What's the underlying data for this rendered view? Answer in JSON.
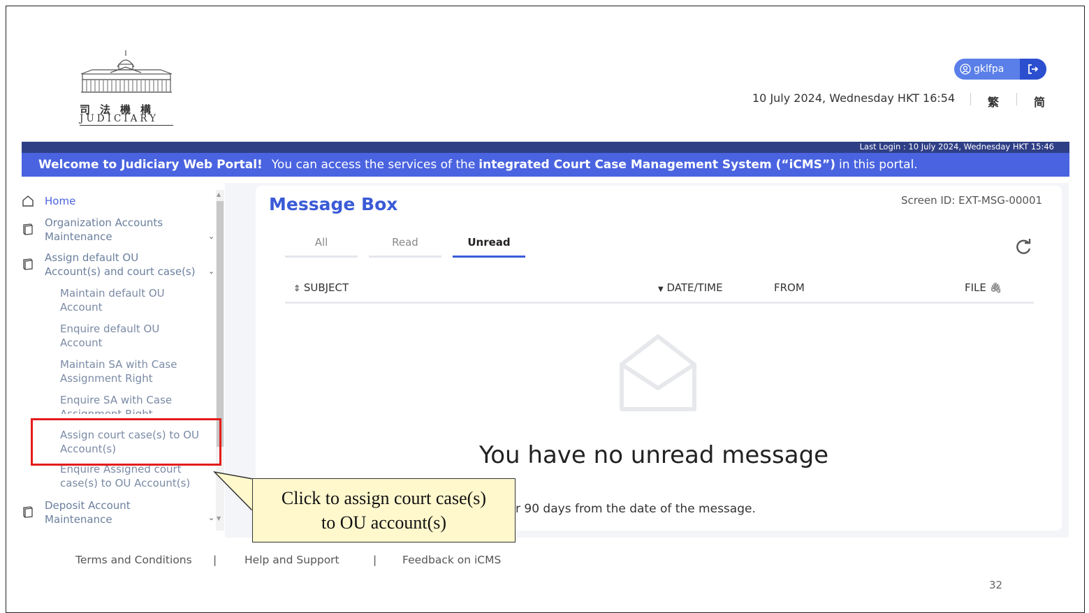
{
  "header": {
    "logo_cn": "司法機構",
    "logo_en": "JUDICIARY",
    "username": "gklfpa",
    "datetime": "10 July 2024, Wednesday HKT 16:54",
    "lang_trad": "繁",
    "lang_simp": "简"
  },
  "banner": {
    "last_login": "Last Login : 10 July 2024, Wednesday HKT 15:46",
    "welcome": "Welcome to Judiciary Web Portal!",
    "text_1": "You can access the services of the",
    "text_bold": "integrated Court Case Management System (“iCMS”)",
    "text_2": "in this portal."
  },
  "sidebar": {
    "home": "Home",
    "org_1": "Organization Accounts",
    "org_2": "Maintenance",
    "assign_1": "Assign default OU",
    "assign_2": "Account(s) and court case(s)",
    "sub1_1": "Maintain default OU",
    "sub1_2": "Account",
    "sub2_1": "Enquire default OU",
    "sub2_2": "Account",
    "sub3_1": "Maintain SA with Case",
    "sub3_2": "Assignment Right",
    "sub4_1": "Enquire SA with Case",
    "sub4_2": "Assignment Right",
    "sub5_1": "Assign court case(s) to OU",
    "sub5_2": "Account(s)",
    "sub6_1": "Enquire Assigned court",
    "sub6_2": "case(s) to OU Account(s)",
    "deposit_1": "Deposit Account",
    "deposit_2": "Maintenance"
  },
  "main": {
    "title": "Message Box",
    "screen_id": "Screen ID: EXT-MSG-00001",
    "tabs": [
      "All",
      "Read",
      "Unread"
    ],
    "columns": {
      "subject": "SUBJECT",
      "datetime": "DATE/TIME",
      "from": "FROM",
      "file": "FILE"
    },
    "empty_message": "You have no unread message",
    "retention": "r 90 days from the date of the message."
  },
  "callout": {
    "line1": "Click to assign court case(s)",
    "line2": "to OU account(s)"
  },
  "footer": {
    "terms": "Terms and Conditions",
    "help": "Help and Support",
    "feedback": "Feedback on iCMS",
    "sep": "|"
  },
  "page_number": "32",
  "colors": {
    "banner": "#4a63e0",
    "banner_dark": "#2f3f86",
    "accent": "#3a5bd6",
    "highlight": "#e41c1c",
    "callout_bg": "#fff8cd"
  }
}
